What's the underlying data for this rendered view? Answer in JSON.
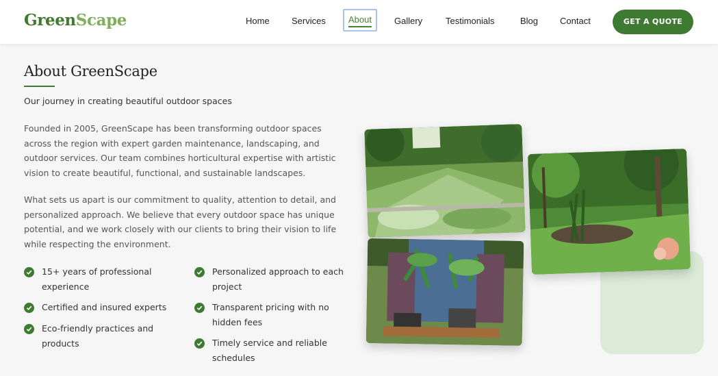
{
  "header": {
    "logo_part1": "Green",
    "logo_part2": "Scape",
    "nav": [
      "Home",
      "Services",
      "About",
      "Gallery",
      "Testimonials",
      "Blog",
      "Contact"
    ],
    "active_nav": "About",
    "cta_label": "GET A QUOTE"
  },
  "about": {
    "title": "About GreenScape",
    "subtitle": "Our journey in creating beautiful outdoor spaces",
    "paragraphs": [
      "Founded in 2005, GreenScape has been transforming outdoor spaces across the region with expert garden maintenance, landscaping, and outdoor services. Our team combines horticultural expertise with artistic vision to create beautiful, functional, and sustainable landscapes.",
      "What sets us apart is our commitment to quality, attention to detail, and personalized approach. We believe that every outdoor space has unique potential, and we work closely with our clients to bring their vision to life while respecting the environment."
    ],
    "features": [
      "15+ years of professional experience",
      "Personalized approach to each project",
      "Certified and insured experts",
      "Transparent pricing with no hidden fees",
      "Eco-friendly practices and products",
      "Timely service and reliable schedules"
    ]
  },
  "colors": {
    "brand_green": "#3f7a32",
    "light_green": "#7fae5e",
    "accent_box": "#dcebd8",
    "page_bg": "#f6f6f6"
  },
  "icons": {
    "feature_check": "check-circle-icon"
  }
}
